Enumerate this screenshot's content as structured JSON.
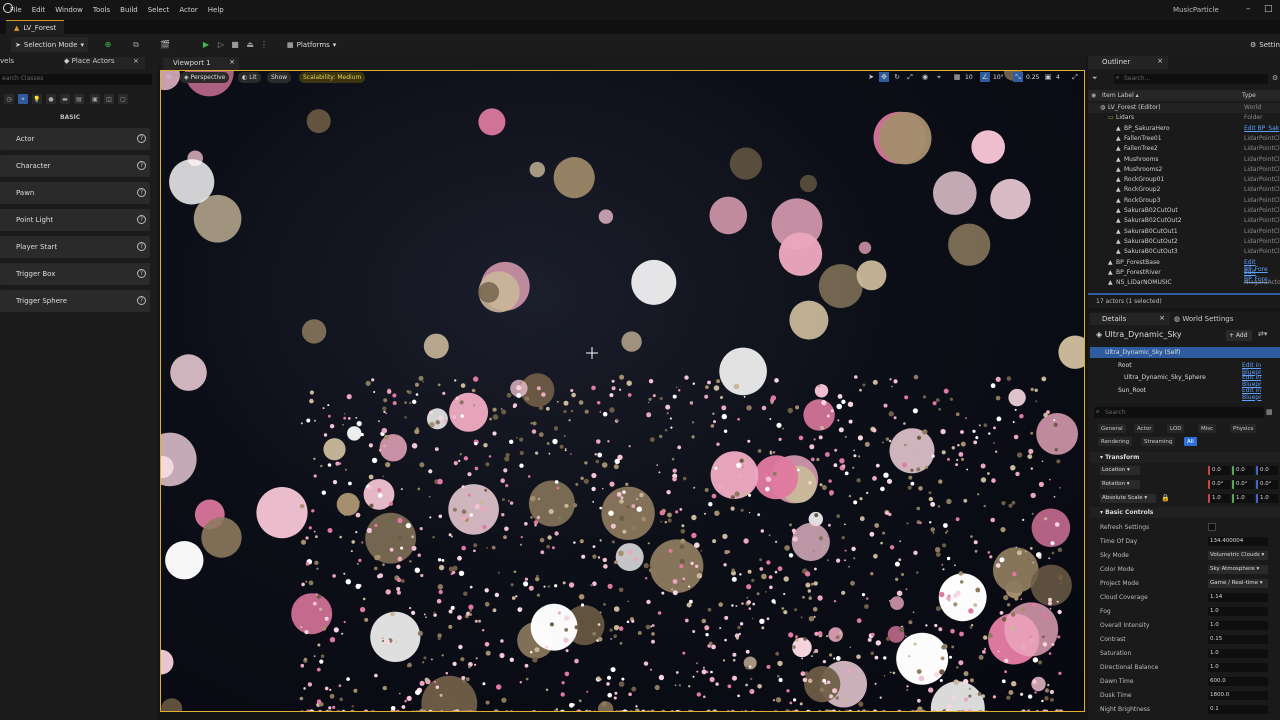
{
  "menubar": {
    "items": [
      "File",
      "Edit",
      "Window",
      "Tools",
      "Build",
      "Select",
      "Actor",
      "Help"
    ],
    "project": "MusicParticle"
  },
  "level_tab": "LV_Forest",
  "toolbar": {
    "mode": "Selection Mode",
    "platforms": "Platforms",
    "settings": "Settin"
  },
  "left_panel": {
    "tab_levels": "vels",
    "tab_place_actors": "Place Actors",
    "search_placeholder": "earch Classes",
    "section": "BASIC",
    "actors": [
      "Actor",
      "Character",
      "Pawn",
      "Point Light",
      "Player Start",
      "Trigger Box",
      "Trigger Sphere"
    ]
  },
  "viewport": {
    "tab": "Viewport 1",
    "perspective": "Perspective",
    "lit": "Lit",
    "show": "Show",
    "scalability": "Scalability: Medium",
    "grid_size": "10",
    "rot_snap": "10°",
    "scale_snap": "0.25",
    "cam_speed": "4"
  },
  "outliner": {
    "title": "Outliner",
    "search_placeholder": "Search...",
    "col_label": "Item Label ▴",
    "col_type": "Type",
    "rows": [
      {
        "name": "LV_Forest (Editor)",
        "type": "World",
        "link": false
      },
      {
        "name": "Lidars",
        "type": "Folder",
        "link": false
      },
      {
        "name": "BP_SakuraHero",
        "type": "Edit BP_Sak",
        "link": true
      },
      {
        "name": "FallenTree01",
        "type": "LidarPointCl",
        "link": false
      },
      {
        "name": "FallenTree2",
        "type": "LidarPointCl",
        "link": false
      },
      {
        "name": "Mushrooms",
        "type": "LidarPointCl",
        "link": false
      },
      {
        "name": "Mushrooms2",
        "type": "LidarPointCl",
        "link": false
      },
      {
        "name": "RockGroup01",
        "type": "LidarPointCl",
        "link": false
      },
      {
        "name": "RockGroup2",
        "type": "LidarPointCl",
        "link": false
      },
      {
        "name": "RockGroup3",
        "type": "LidarPointCl",
        "link": false
      },
      {
        "name": "SakuraB02CutOut",
        "type": "LidarPointCl",
        "link": false
      },
      {
        "name": "SakuraB02CutOut2",
        "type": "LidarPointCl",
        "link": false
      },
      {
        "name": "SakuraB0CutOut1",
        "type": "LidarPointCl",
        "link": false
      },
      {
        "name": "SakuraB0CutOut2",
        "type": "LidarPointCl",
        "link": false
      },
      {
        "name": "SakuraB0CutOut3",
        "type": "LidarPointCl",
        "link": false
      },
      {
        "name": "BP_ForestBase",
        "type": "Edit BP_Fore",
        "link": true
      },
      {
        "name": "BP_ForestRiver",
        "type": "Edit BP_Fore",
        "link": true
      },
      {
        "name": "NS_LiDarNOMUSIC",
        "type": "NiagaraActo",
        "link": false
      }
    ],
    "count": "17 actors (1 selected)"
  },
  "details": {
    "tab_details": "Details",
    "tab_world": "World Settings",
    "object": "Ultra_Dynamic_Sky",
    "add": "+ Add",
    "components": [
      {
        "name": "Ultra_Dynamic_Sky (Self)",
        "edit": ""
      },
      {
        "name": "Root",
        "edit": "Edit in Bluepr"
      },
      {
        "name": "Ultra_Dynamic_Sky_Sphere",
        "edit": "Edit in Bluepr"
      },
      {
        "name": "Sun_Root",
        "edit": "Edit in Bluepr"
      },
      {
        "name": "Rainbow",
        "edit": ""
      }
    ],
    "search_placeholder": "Search",
    "categories_row1": [
      "General",
      "Actor",
      "LOD",
      "Misc",
      "Physics"
    ],
    "categories_row2": [
      "Rendering",
      "Streaming",
      "All"
    ],
    "transform": {
      "title": "Transform",
      "location_label": "Location",
      "location": [
        "0.0",
        "0.0",
        "0.0"
      ],
      "rotation_label": "Rotation",
      "rotation": [
        "0.0°",
        "0.0°",
        "0.0°"
      ],
      "scale_label": "Absolute Scale",
      "scale": [
        "1.0",
        "1.0",
        "1.0"
      ]
    },
    "basic_controls": {
      "title": "Basic Controls",
      "props": [
        {
          "label": "Refresh Settings",
          "value": "",
          "kind": "check"
        },
        {
          "label": "Time Of Day",
          "value": "134.400004",
          "kind": "field"
        },
        {
          "label": "Sky Mode",
          "value": "Volumetric Clouds",
          "kind": "drop"
        },
        {
          "label": "Color Mode",
          "value": "Sky Atmosphere",
          "kind": "drop"
        },
        {
          "label": "Project Mode",
          "value": "Game / Real-time",
          "kind": "drop"
        },
        {
          "label": "Cloud Coverage",
          "value": "1.14",
          "kind": "field"
        },
        {
          "label": "Fog",
          "value": "1.0",
          "kind": "field"
        },
        {
          "label": "Overall Intensity",
          "value": "1.0",
          "kind": "field"
        },
        {
          "label": "Contrast",
          "value": "0.15",
          "kind": "field"
        },
        {
          "label": "Saturation",
          "value": "1.0",
          "kind": "field"
        },
        {
          "label": "Directional Balance",
          "value": "1.0",
          "kind": "field"
        },
        {
          "label": "Dawn Time",
          "value": "600.0",
          "kind": "field"
        },
        {
          "label": "Dusk Time",
          "value": "1800.0",
          "kind": "field"
        },
        {
          "label": "Night Brightness",
          "value": "0.1",
          "kind": "field"
        }
      ]
    }
  },
  "colors": {
    "accent": "#e0b030",
    "selection": "#2f5c9e",
    "link": "#5da0ff",
    "particle_pink": "#f0b3c8",
    "particle_tan": "#8c7a5e",
    "particle_red": "#d04040"
  }
}
